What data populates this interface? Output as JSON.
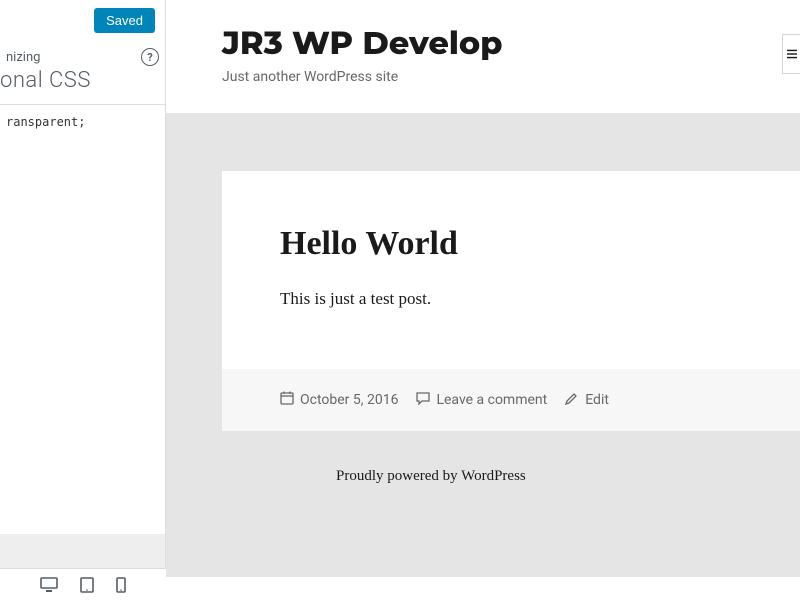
{
  "sidebar": {
    "saved_button": "Saved",
    "breadcrumb": "nizing",
    "section_title": "onal CSS",
    "css_line": "ransparent;"
  },
  "preview": {
    "site_title": "JR3 WP Develop",
    "tagline": "Just another WordPress site",
    "post": {
      "title": "Hello World",
      "content": "This is just a test post.",
      "meta": {
        "date": "October 5, 2016",
        "comment": "Leave a comment",
        "edit": "Edit"
      }
    },
    "footer": "Proudly powered by WordPress"
  }
}
